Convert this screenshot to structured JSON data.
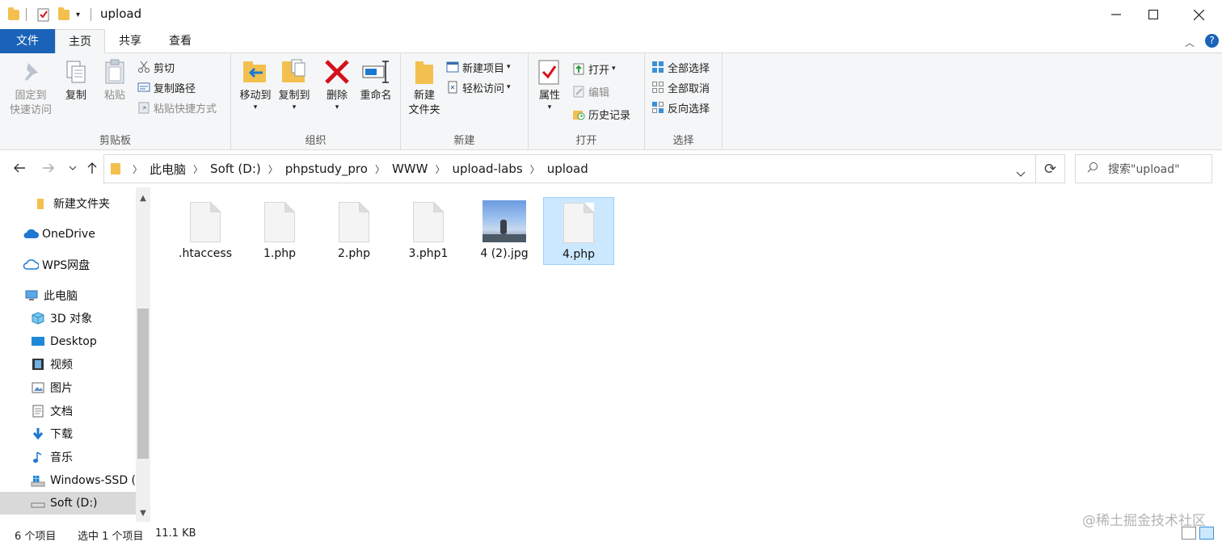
{
  "window": {
    "title": "upload"
  },
  "ribbon_tabs": [
    "文件",
    "主页",
    "共享",
    "查看"
  ],
  "ribbon": {
    "clipboard": {
      "label": "剪贴板",
      "pin_line1": "固定到",
      "pin_line2": "快速访问",
      "copy": "复制",
      "paste": "粘贴",
      "cut": "剪切",
      "copy_path": "复制路径",
      "paste_shortcut": "粘贴快捷方式"
    },
    "organize": {
      "label": "组织",
      "move_to": "移动到",
      "copy_to": "复制到",
      "delete": "删除",
      "rename": "重命名"
    },
    "new": {
      "label": "新建",
      "new_folder_line1": "新建",
      "new_folder_line2": "文件夹",
      "new_item": "新建项目",
      "easy_access": "轻松访问"
    },
    "open": {
      "label": "打开",
      "properties": "属性",
      "open": "打开",
      "edit": "编辑",
      "history": "历史记录"
    },
    "select": {
      "label": "选择",
      "select_all": "全部选择",
      "select_none": "全部取消",
      "invert": "反向选择"
    }
  },
  "address": {
    "crumbs": [
      "此电脑",
      "Soft (D:)",
      "phpstudy_pro",
      "WWW",
      "upload-labs",
      "upload"
    ],
    "search_placeholder": "搜索\"upload\""
  },
  "nav": {
    "items": [
      {
        "label": "新建文件夹",
        "icon": "folder-icon"
      },
      {
        "label": "OneDrive",
        "icon": "cloud-icon"
      },
      {
        "label": "WPS网盘",
        "icon": "cloud-outline-icon"
      },
      {
        "label": "此电脑",
        "icon": "computer-icon"
      },
      {
        "label": "3D 对象",
        "icon": "cube-icon"
      },
      {
        "label": "Desktop",
        "icon": "desktop-icon"
      },
      {
        "label": "视频",
        "icon": "video-icon"
      },
      {
        "label": "图片",
        "icon": "picture-icon"
      },
      {
        "label": "文档",
        "icon": "document-icon"
      },
      {
        "label": "下载",
        "icon": "download-icon"
      },
      {
        "label": "音乐",
        "icon": "music-icon"
      },
      {
        "label": "Windows-SSD (",
        "icon": "windows-drive-icon"
      },
      {
        "label": "Soft (D:)",
        "icon": "drive-icon"
      }
    ]
  },
  "files": [
    {
      "name": ".htaccess",
      "type": "file"
    },
    {
      "name": "1.php",
      "type": "file"
    },
    {
      "name": "2.php",
      "type": "file"
    },
    {
      "name": "3.php1",
      "type": "file"
    },
    {
      "name": "4 (2).jpg",
      "type": "image"
    },
    {
      "name": "4.php",
      "type": "file",
      "selected": true
    }
  ],
  "status": {
    "count": "6 个项目",
    "selected": "选中 1 个项目",
    "size": "11.1 KB"
  },
  "watermark": "@稀土掘金技术社区",
  "colors": {
    "accent": "#1a63b8",
    "selection": "#cce8ff",
    "folder": "#f3c04f",
    "delete": "#d4121b"
  }
}
